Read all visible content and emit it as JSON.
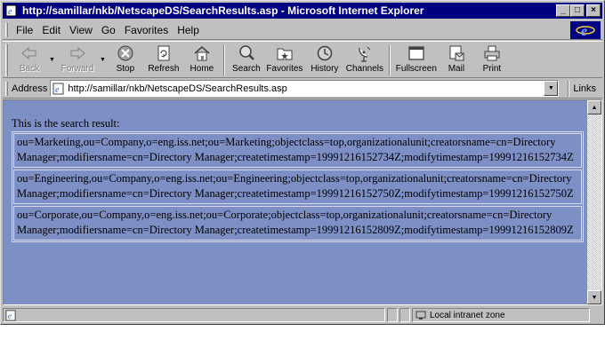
{
  "window": {
    "title": "http://samillar/nkb/NetscapeDS/SearchResults.asp - Microsoft Internet Explorer",
    "minimize_label": "_",
    "maximize_label": "□",
    "close_label": "×"
  },
  "menu": [
    "File",
    "Edit",
    "View",
    "Go",
    "Favorites",
    "Help"
  ],
  "toolbar": {
    "back": "Back",
    "forward": "Forward",
    "stop": "Stop",
    "refresh": "Refresh",
    "home": "Home",
    "search": "Search",
    "favorites": "Favorites",
    "history": "History",
    "channels": "Channels",
    "fullscreen": "Fullscreen",
    "mail": "Mail",
    "print": "Print"
  },
  "address": {
    "label": "Address",
    "url": "http://samillar/nkb/NetscapeDS/SearchResults.asp",
    "links": "Links"
  },
  "content": {
    "intro": "This is the search result:",
    "results": [
      "ou=Marketing,ou=Company,o=eng.iss.net;ou=Marketing;objectclass=top,organizationalunit;creatorsname=cn=Directory Manager;modifiersname=cn=Directory Manager;createtimestamp=19991216152734Z;modifytimestamp=19991216152734Z",
      "ou=Engineering,ou=Company,o=eng.iss.net;ou=Engineering;objectclass=top,organizationalunit;creatorsname=cn=Directory Manager;modifiersname=cn=Directory Manager;createtimestamp=19991216152750Z;modifytimestamp=19991216152750Z",
      "ou=Corporate,ou=Company,o=eng.iss.net;ou=Corporate;objectclass=top,organizationalunit;creatorsname=cn=Directory Manager;modifiersname=cn=Directory Manager;createtimestamp=19991216152809Z;modifytimestamp=19991216152809Z"
    ]
  },
  "status": {
    "zone": "Local intranet zone"
  },
  "colors": {
    "titlebar": "#000080",
    "content_bg": "#7d8fc4",
    "chrome": "#c0c0c0"
  }
}
